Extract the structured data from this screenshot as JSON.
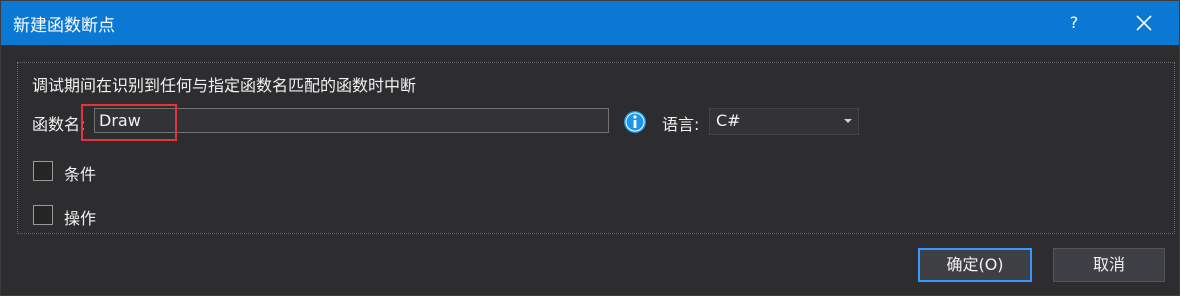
{
  "window": {
    "title": "新建函数断点",
    "help_glyph": "?"
  },
  "group": {
    "description": "调试期间在识别到任何与指定函数名匹配的函数时中断",
    "function_name_label": "函数名:",
    "function_name_value": "Draw",
    "language_label": "语言:",
    "language_value": "C#"
  },
  "options": {
    "condition_label": "条件",
    "action_label": "操作"
  },
  "buttons": {
    "ok_label": "确定(O)",
    "cancel_label": "取消"
  },
  "colors": {
    "titlebar": "#0b78d4",
    "highlight_border": "#e0353b",
    "info_icon": "#1c97ea"
  },
  "icons": [
    "help-icon",
    "close-icon",
    "info-icon",
    "chevron-down-icon"
  ]
}
